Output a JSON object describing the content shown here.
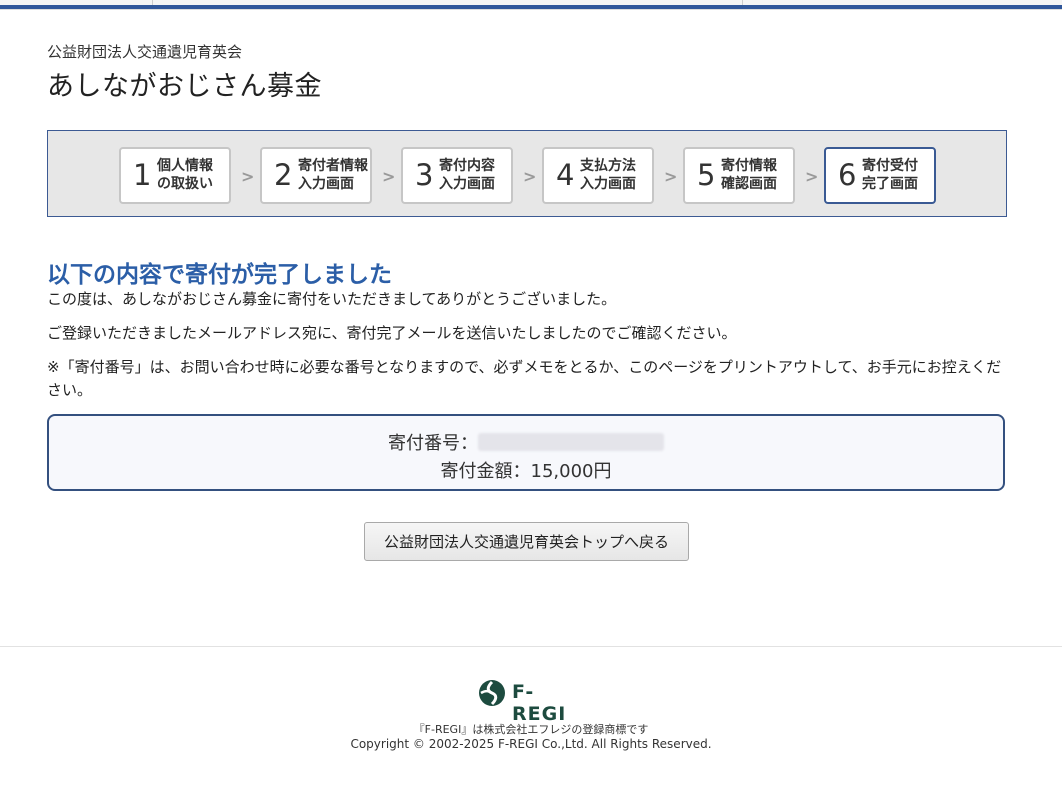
{
  "header": {
    "org_name": "公益財団法人交通遺児育英会",
    "campaign_title": "あしながおじさん募金"
  },
  "steps": [
    {
      "num": "1",
      "line1": "個人情報",
      "line2": "の取扱い"
    },
    {
      "num": "2",
      "line1": "寄付者情報",
      "line2": "入力画面"
    },
    {
      "num": "3",
      "line1": "寄付内容",
      "line2": "入力画面"
    },
    {
      "num": "4",
      "line1": "支払方法",
      "line2": "入力画面"
    },
    {
      "num": "5",
      "line1": "寄付情報",
      "line2": "確認画面"
    },
    {
      "num": "6",
      "line1": "寄付受付",
      "line2": "完了画面"
    }
  ],
  "active_step": 6,
  "main": {
    "done_title": "以下の内容で寄付が完了しました",
    "msg1": "この度は、あしながおじさん募金に寄付をいただきましてありがとうございました。",
    "msg2": "ご登録いただきましたメールアドレス宛に、寄付完了メールを送信いたしましたのでご確認ください。",
    "msg3": "※「寄付番号」は、お問い合わせ時に必要な番号となりますので、必ずメモをとるか、このページをプリントアウトして、お手元にお控えください。"
  },
  "info": {
    "donation_number_label": "寄付番号：",
    "donation_amount_label": "寄付金額：",
    "donation_amount": "15,000円"
  },
  "back_button": "公益財団法人交通遺児育英会トップへ戻る",
  "footer": {
    "logo_text": "F-REGI",
    "trademark": "『F-REGI』は株式会社エフレジの登録商標です",
    "copyright": "Copyright © 2002-2025 F-REGI Co.,Ltd. All Rights Reserved."
  },
  "colors": {
    "accent_blue": "#2b5ea7",
    "nav_border": "#3c5a93",
    "logo_green": "#1d4b3f"
  }
}
